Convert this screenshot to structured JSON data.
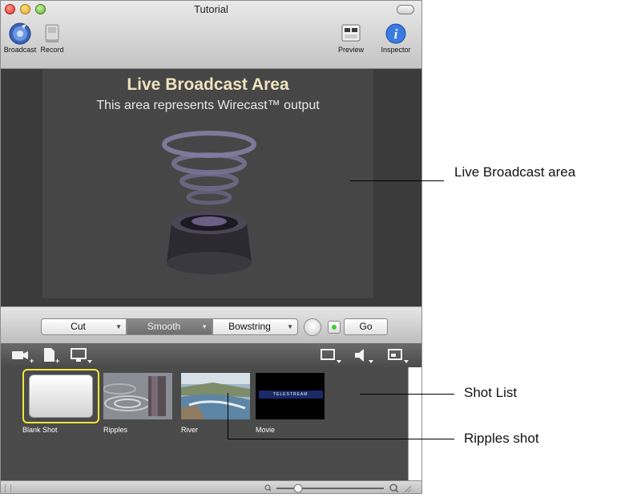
{
  "window": {
    "title": "Tutorial"
  },
  "toolbar": {
    "broadcast_label": "Broadcast",
    "record_label": "Record",
    "preview_label": "Preview",
    "inspector_label": "Inspector"
  },
  "broadcast_area": {
    "title": "Live Broadcast Area",
    "subtitle": "This area represents Wirecast™ output"
  },
  "transitions": {
    "cut_label": "Cut",
    "smooth_label": "Smooth",
    "bowstring_label": "Bowstring",
    "go_label": "Go"
  },
  "shots": [
    {
      "name": "Blank Shot",
      "selected": true
    },
    {
      "name": "Ripples",
      "selected": false
    },
    {
      "name": "River",
      "selected": false
    },
    {
      "name": "Movie",
      "selected": false
    }
  ],
  "movie_thumb_text": "TELESTREAM",
  "callouts": {
    "live_broadcast": "Live Broadcast area",
    "shot_list": "Shot List",
    "ripples_shot": "Ripples shot"
  },
  "colors": {
    "selection_outline": "#f2e43a",
    "go_indicator": "#3ccf2c",
    "title_text": "#efe3c0"
  }
}
